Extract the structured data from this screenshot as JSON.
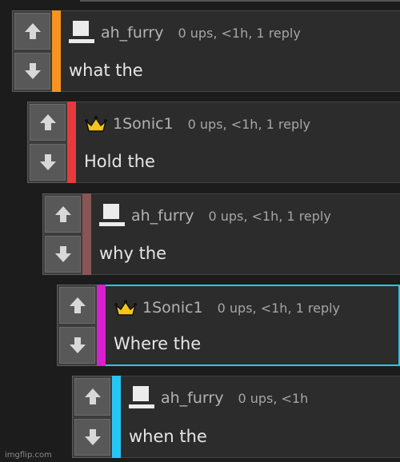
{
  "comments": [
    {
      "user": "ah_furry",
      "stats": "0 ups, <1h, 1 reply",
      "text": "what the",
      "avatar": "blank-avatar",
      "bar_color": "#f7931e",
      "highlight": false
    },
    {
      "user": "1Sonic1",
      "stats": "0 ups, <1h, 1 reply",
      "text": "Hold the",
      "avatar": "crown",
      "bar_color": "#e8393c",
      "highlight": false
    },
    {
      "user": "ah_furry",
      "stats": "0 ups, <1h, 1 reply",
      "text": "why the",
      "avatar": "blank-avatar",
      "bar_color": "#8a5555",
      "highlight": false
    },
    {
      "user": "1Sonic1",
      "stats": "0 ups, <1h, 1 reply",
      "text": "Where the",
      "avatar": "crown",
      "bar_color": "#d91fd0",
      "highlight": true
    },
    {
      "user": "ah_furry",
      "stats": "0 ups, <1h",
      "text": "when the",
      "avatar": "blank-avatar",
      "bar_color": "#26c6f4",
      "highlight": false
    }
  ],
  "watermark": "imgflip.com",
  "colors": {
    "highlight_border": "#26c6f4",
    "crown": "#f5c518",
    "background": "#1c1c1c"
  }
}
